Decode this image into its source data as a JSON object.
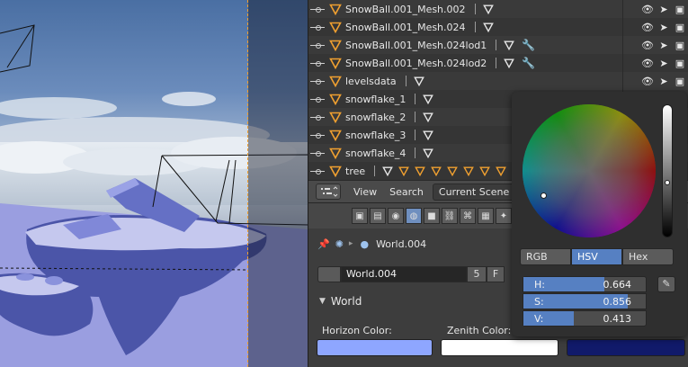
{
  "outliner": {
    "rows": [
      {
        "name": "SnowBall.001_Mesh.002",
        "minis": 1,
        "wrench": false
      },
      {
        "name": "SnowBall.001_Mesh.024",
        "minis": 1,
        "wrench": false
      },
      {
        "name": "SnowBall.001_Mesh.024lod1",
        "minis": 1,
        "wrench": true
      },
      {
        "name": "SnowBall.001_Mesh.024lod2",
        "minis": 1,
        "wrench": true
      },
      {
        "name": "levelsdata",
        "minis": 1,
        "wrench": false
      },
      {
        "name": "snowflake_1",
        "minis": 1,
        "wrench": false
      },
      {
        "name": "snowflake_2",
        "minis": 1,
        "wrench": false
      },
      {
        "name": "snowflake_3",
        "minis": 1,
        "wrench": false
      },
      {
        "name": "snowflake_4",
        "minis": 1,
        "wrench": false
      },
      {
        "name": "tree",
        "minis": 8,
        "wrench": false
      }
    ]
  },
  "header": {
    "view_label": "View",
    "search_label": "Search",
    "display_mode": "Current Scene"
  },
  "properties": {
    "breadcrumb": "World.004",
    "world_name": "World.004",
    "world_users": "5",
    "fake_user": "F",
    "panel_title": "World",
    "horizon_label": "Horizon Color:",
    "zenith_label": "Zenith Color:",
    "horizon_color": "#8ea6ff",
    "zenith_color": "#ffffff",
    "ambient_color": "#111a6a"
  },
  "picker": {
    "modes": [
      "RGB",
      "HSV",
      "Hex"
    ],
    "active_mode": "HSV",
    "h_label": "H:",
    "s_label": "S:",
    "v_label": "V:",
    "h_value": "0.664",
    "s_value": "0.856",
    "v_value": "0.413",
    "h": 0.664,
    "s": 0.856,
    "v": 0.413
  },
  "colors": {
    "accent": "#5680c2",
    "object_icon": "#f0a030"
  }
}
